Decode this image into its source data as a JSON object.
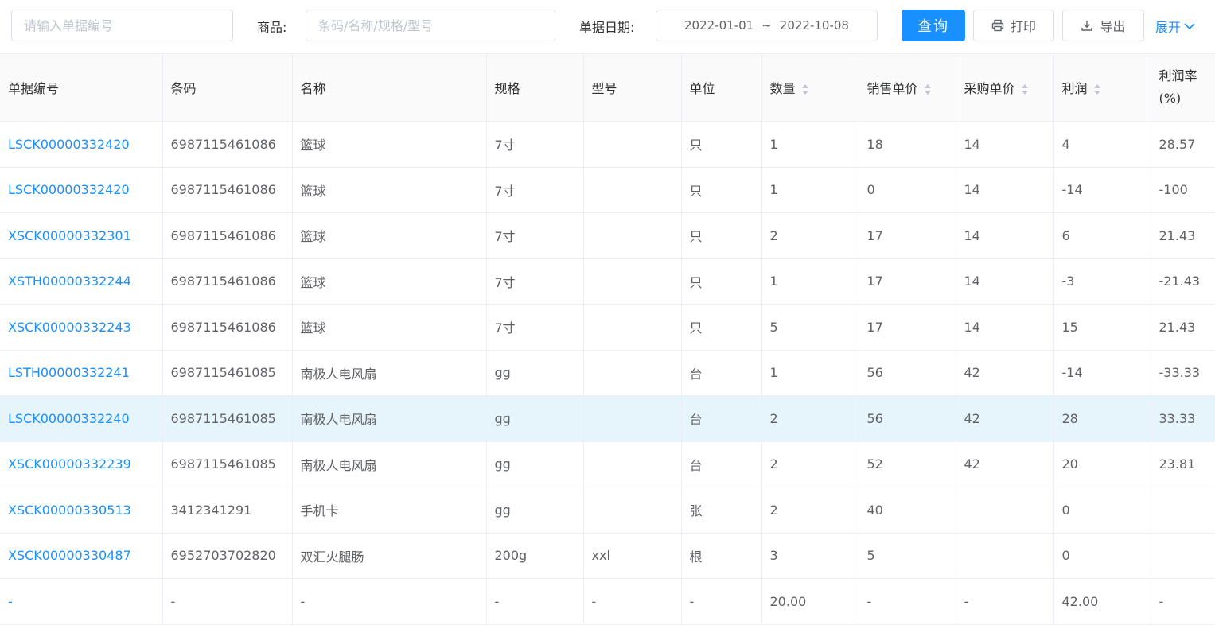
{
  "filters": {
    "doc_no_placeholder": "请输入单据编号",
    "goods_label": "商品:",
    "goods_placeholder": "条码/名称/规格/型号",
    "date_label": "单据日期:",
    "date_start": "2022-01-01",
    "date_sep": "~",
    "date_end": "2022-10-08"
  },
  "actions": {
    "query": "查询",
    "print": "打印",
    "export": "导出",
    "expand": "展开"
  },
  "columns": [
    "单据编号",
    "条码",
    "名称",
    "规格",
    "型号",
    "单位",
    "数量",
    "销售单价",
    "采购单价",
    "利润",
    "利润率(%)"
  ],
  "rows": [
    [
      "LSCK00000332420",
      "6987115461086",
      "篮球",
      "7寸",
      "",
      "只",
      "1",
      "18",
      "14",
      "4",
      "28.57"
    ],
    [
      "LSCK00000332420",
      "6987115461086",
      "篮球",
      "7寸",
      "",
      "只",
      "1",
      "0",
      "14",
      "-14",
      "-100"
    ],
    [
      "XSCK00000332301",
      "6987115461086",
      "篮球",
      "7寸",
      "",
      "只",
      "2",
      "17",
      "14",
      "6",
      "21.43"
    ],
    [
      "XSTH00000332244",
      "6987115461086",
      "篮球",
      "7寸",
      "",
      "只",
      "1",
      "17",
      "14",
      "-3",
      "-21.43"
    ],
    [
      "XSCK00000332243",
      "6987115461086",
      "篮球",
      "7寸",
      "",
      "只",
      "5",
      "17",
      "14",
      "15",
      "21.43"
    ],
    [
      "LSTH00000332241",
      "6987115461085",
      "南极人电风扇",
      "gg",
      "",
      "台",
      "1",
      "56",
      "42",
      "-14",
      "-33.33"
    ],
    [
      "LSCK00000332240",
      "6987115461085",
      "南极人电风扇",
      "gg",
      "",
      "台",
      "2",
      "56",
      "42",
      "28",
      "33.33"
    ],
    [
      "XSCK00000332239",
      "6987115461085",
      "南极人电风扇",
      "gg",
      "",
      "台",
      "2",
      "52",
      "42",
      "20",
      "23.81"
    ],
    [
      "XSCK00000330513",
      "3412341291",
      "手机卡",
      "gg",
      "",
      "张",
      "2",
      "40",
      "",
      "0",
      ""
    ],
    [
      "XSCK00000330487",
      "6952703702820",
      "双汇火腿肠",
      "200g",
      "xxl",
      "根",
      "3",
      "5",
      "",
      "0",
      ""
    ],
    [
      "-",
      "-",
      "-",
      "-",
      "-",
      "-",
      "20.00",
      "-",
      "-",
      "42.00",
      "-"
    ]
  ],
  "highlight_row": 6,
  "colors": {
    "primary": "#1890ff",
    "highlight": "#e6f5fc",
    "border": "#ebeef5"
  }
}
